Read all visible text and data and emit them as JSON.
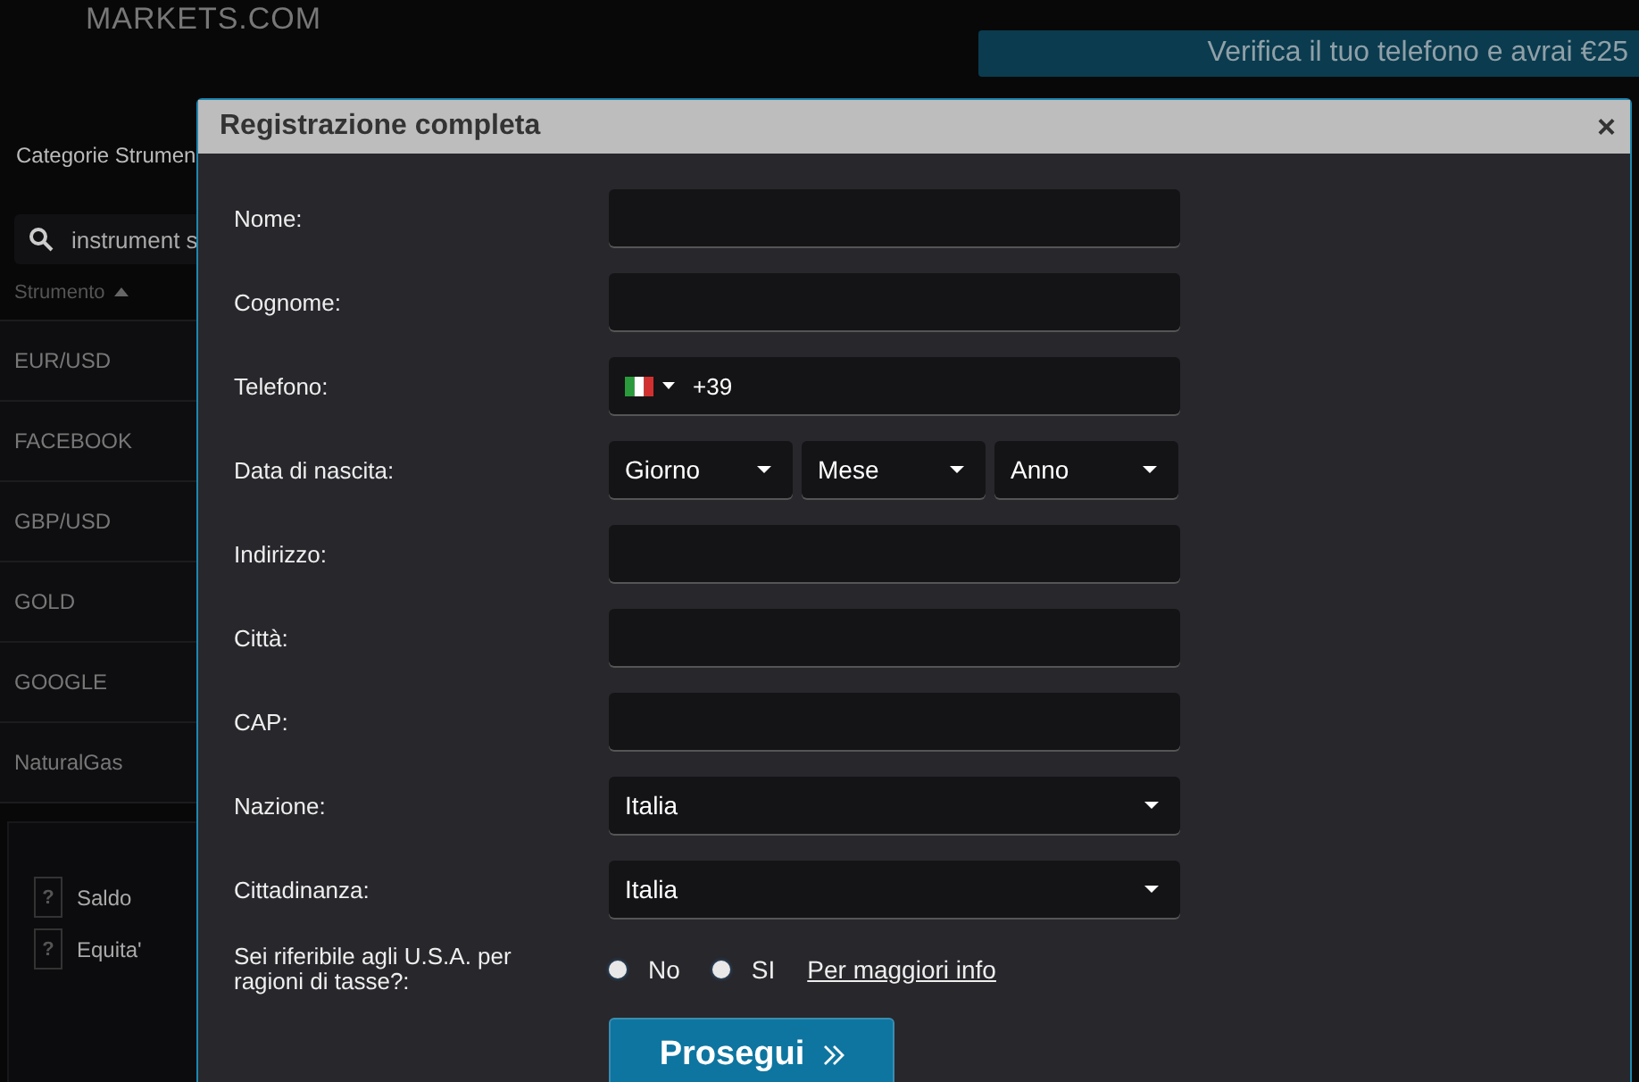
{
  "header": {
    "logo": "MARKETS.COM",
    "promo_banner": "Verifica il tuo telefono e avrai €25"
  },
  "sidebar": {
    "title": "Categorie Strumen",
    "search": {
      "value": "instrument s"
    },
    "column": "Strumento",
    "instruments": [
      "EUR/USD",
      "FACEBOOK",
      "GBP/USD",
      "GOLD",
      "GOOGLE",
      "NaturalGas"
    ],
    "account": [
      {
        "label": "Saldo",
        "help": "?"
      },
      {
        "label": "Equita'",
        "help": "?"
      }
    ]
  },
  "dialog": {
    "title": "Registrazione completa",
    "close": "×",
    "fields": [
      {
        "kind": "text",
        "label": "Nome:"
      },
      {
        "kind": "text",
        "label": "Cognome:"
      },
      {
        "kind": "phone",
        "label": "Telefono:",
        "code": "+39"
      },
      {
        "kind": "date",
        "label": "Data di nascita:",
        "parts": [
          "Giorno",
          "Mese",
          "Anno"
        ]
      },
      {
        "kind": "text",
        "label": "Indirizzo:"
      },
      {
        "kind": "text",
        "label": "Città:"
      },
      {
        "kind": "text",
        "label": "CAP:"
      },
      {
        "kind": "select",
        "label": "Nazione:",
        "value": "Italia"
      },
      {
        "kind": "select",
        "label": "Cittadinanza:",
        "value": "Italia"
      }
    ],
    "tax_question": {
      "label": "Sei riferibile agli U.S.A. per ragioni di tasse?:",
      "options": [
        {
          "label": "No",
          "selected": false
        },
        {
          "label": "SI",
          "selected": false
        }
      ],
      "link": "Per maggiori info"
    },
    "submit": "Prosegui"
  }
}
